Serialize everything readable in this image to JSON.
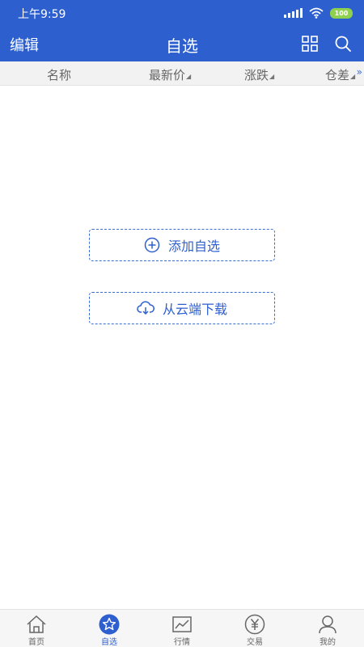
{
  "status_bar": {
    "time": "上午9:59",
    "battery": "100"
  },
  "header": {
    "edit_label": "编辑",
    "title": "自选"
  },
  "columns": [
    {
      "label": "名称",
      "sortable": false
    },
    {
      "label": "最新价",
      "sortable": true
    },
    {
      "label": "涨跌",
      "sortable": true
    },
    {
      "label": "仓差",
      "sortable": true
    }
  ],
  "actions": {
    "add_label": "添加自选",
    "cloud_label": "从云端下载"
  },
  "tabs": [
    {
      "label": "首页",
      "icon": "home-icon",
      "active": false
    },
    {
      "label": "自选",
      "icon": "star-icon",
      "active": true
    },
    {
      "label": "行情",
      "icon": "chart-icon",
      "active": false
    },
    {
      "label": "交易",
      "icon": "yen-icon",
      "active": false
    },
    {
      "label": "我的",
      "icon": "user-icon",
      "active": false
    }
  ],
  "colors": {
    "primary": "#2e5fcf",
    "battery": "#8fd14f",
    "header_bg": "#f2f2f2"
  }
}
